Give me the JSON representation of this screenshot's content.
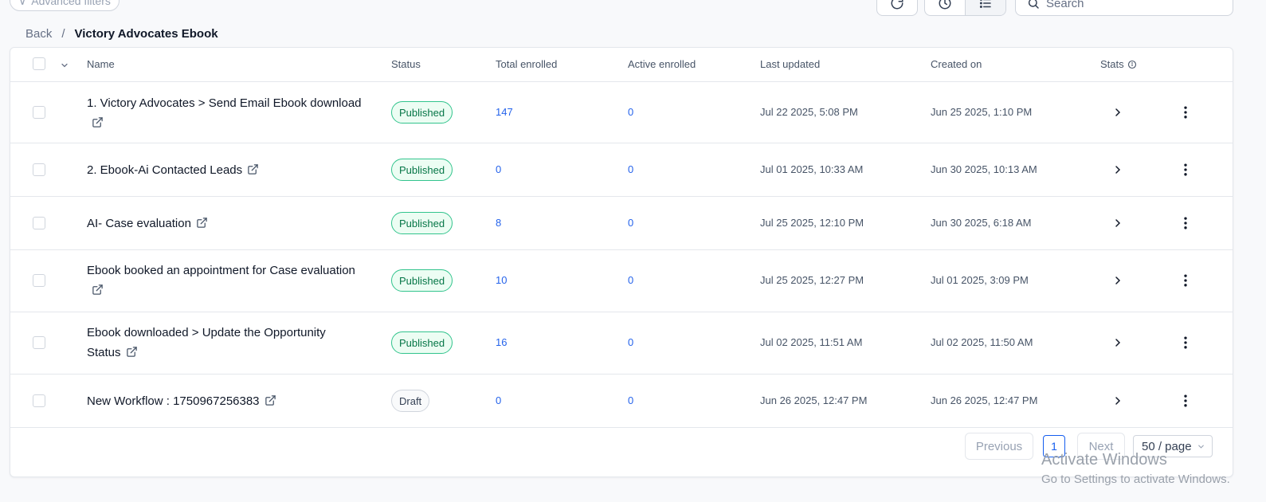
{
  "toolbar": {
    "advanced_filters": "Advanced filters",
    "search_placeholder": "Search"
  },
  "breadcrumb": {
    "back": "Back",
    "separator": "/",
    "current": "Victory Advocates Ebook"
  },
  "table": {
    "headers": {
      "name": "Name",
      "status": "Status",
      "total_enrolled": "Total enrolled",
      "active_enrolled": "Active enrolled",
      "last_updated": "Last updated",
      "created_on": "Created on",
      "stats": "Stats"
    },
    "rows": [
      {
        "name": "1. Victory Advocates > Send Email Ebook download",
        "status": "Published",
        "total": "147",
        "active": "0",
        "updated": "Jul 22 2025, 5:08 PM",
        "created": "Jun 25 2025, 1:10 PM"
      },
      {
        "name": "2. Ebook-Ai Contacted Leads",
        "status": "Published",
        "total": "0",
        "active": "0",
        "updated": "Jul 01 2025, 10:33 AM",
        "created": "Jun 30 2025, 10:13 AM"
      },
      {
        "name": "AI- Case evaluation",
        "status": "Published",
        "total": "8",
        "active": "0",
        "updated": "Jul 25 2025, 12:10 PM",
        "created": "Jun 30 2025, 6:18 AM"
      },
      {
        "name": "Ebook booked an appointment for Case evaluation",
        "status": "Published",
        "total": "10",
        "active": "0",
        "updated": "Jul 25 2025, 12:27 PM",
        "created": "Jul 01 2025, 3:09 PM"
      },
      {
        "name": "Ebook downloaded > Update the Opportunity Status",
        "status": "Published",
        "total": "16",
        "active": "0",
        "updated": "Jul 02 2025, 11:51 AM",
        "created": "Jul 02 2025, 11:50 AM"
      },
      {
        "name": "New Workflow : 1750967256383",
        "status": "Draft",
        "total": "0",
        "active": "0",
        "updated": "Jun 26 2025, 12:47 PM",
        "created": "Jun 26 2025, 12:47 PM"
      }
    ]
  },
  "pagination": {
    "previous": "Previous",
    "current_page": "1",
    "next": "Next",
    "per_page": "50 / page"
  },
  "watermark": {
    "line1": "Activate Windows",
    "line2": "Go to Settings to activate Windows."
  },
  "colors": {
    "accent": "#155eef",
    "published_border": "#32c48d",
    "published_text": "#067647",
    "link_number": "#2563eb"
  }
}
